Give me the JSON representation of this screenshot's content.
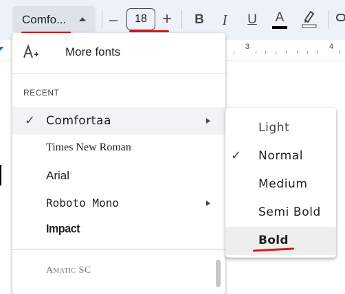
{
  "toolbar": {
    "font_name": "Comfo...",
    "font_size": "18",
    "minus": "–",
    "plus": "+",
    "bold": "B",
    "italic": "I",
    "underline": "U",
    "text_color": "A"
  },
  "ruler": {
    "marks": [
      "3",
      "4"
    ]
  },
  "menu": {
    "more_fonts": "More fonts",
    "recent_header": "RECENT",
    "fonts": [
      {
        "label": "Comfortaa",
        "selected": true,
        "has_submenu": true
      },
      {
        "label": "Times New Roman",
        "selected": false,
        "has_submenu": false
      },
      {
        "label": "Arial",
        "selected": false,
        "has_submenu": false
      },
      {
        "label": "Roboto Mono",
        "selected": false,
        "has_submenu": true
      },
      {
        "label": "Impact",
        "selected": false,
        "has_submenu": false
      }
    ],
    "next_font": "Amatic SC",
    "check": "✓"
  },
  "submenu": {
    "weights": [
      {
        "label": "Light",
        "selected": false
      },
      {
        "label": "Normal",
        "selected": true
      },
      {
        "label": "Medium",
        "selected": false
      },
      {
        "label": "Semi Bold",
        "selected": false
      },
      {
        "label": "Bold",
        "selected": false,
        "hovered": true
      }
    ]
  },
  "colors": {
    "toolbar_bg": "#edf2fa",
    "select_bg": "#dde3ea",
    "annotation_red": "#d81b1b",
    "hover_bg": "#f1f3f4",
    "text_color_bar": "#000000"
  }
}
